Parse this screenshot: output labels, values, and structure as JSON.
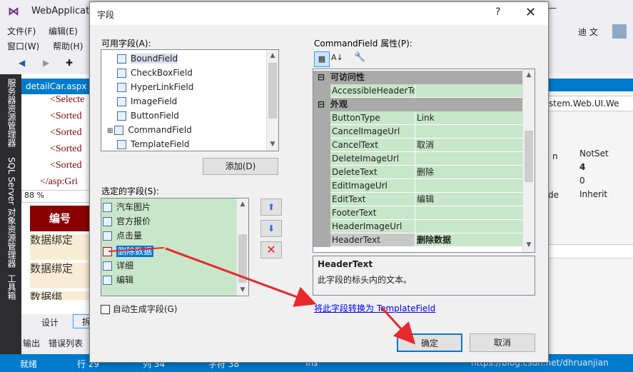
{
  "vs": {
    "title": "WebApplicatio",
    "menu": [
      "文件(F)",
      "编辑(E)",
      "窗口(W)",
      "帮助(H)"
    ],
    "right_menu": [
      "迪 文"
    ],
    "editor_tab": "detailCar.aspx",
    "code_lines": [
      "<Selecte",
      "<Sorted",
      "<Sorted",
      "<Sorted",
      "<Sorted",
      "</asp:Gri"
    ],
    "zoom": "88 %",
    "grid_header": "编号",
    "grid_cells": [
      "数据绑定",
      "数据绑定",
      "数据绑"
    ],
    "bottom_tabs": [
      "设计",
      "拆"
    ],
    "output_tabs": [
      "输出",
      "错误列表"
    ],
    "left_strip": [
      "服务器资源管理器",
      "SQL Server 对象资源管理器",
      "工具箱"
    ],
    "status": {
      "ready": "就绪",
      "line": "行 29",
      "col": "列 34",
      "ch": "字符 38",
      "ins": "Ins"
    },
    "right_panel": {
      "type": "stem.Web.UI.We",
      "rows": [
        [
          "n",
          "NotSet"
        ],
        [
          "",
          "4"
        ],
        [
          "",
          "0"
        ],
        [
          "de",
          "Inherit"
        ]
      ]
    },
    "watermark": "https://blog.csdn.net/dhruanjian"
  },
  "dialog": {
    "title": "字段",
    "help": "?",
    "close": "✕",
    "available_label": "可用字段(A):",
    "available_fields": [
      "BoundField",
      "CheckBoxField",
      "HyperLinkField",
      "ImageField",
      "ButtonField",
      "CommandField",
      "TemplateField"
    ],
    "add_button": "添加(D)",
    "selected_label": "选定的字段(S):",
    "selected_fields": [
      "汽车图片",
      "官方报价",
      "点击量",
      "删除数据",
      "详细",
      "编辑"
    ],
    "auto_generate": "自动生成字段(G)",
    "props_label": "CommandField 属性(P):",
    "categories": [
      "可访问性",
      "外观"
    ],
    "properties": [
      {
        "name": "AccessibleHeaderTe",
        "value": ""
      },
      {
        "name": "ButtonType",
        "value": "Link"
      },
      {
        "name": "CancelImageUrl",
        "value": ""
      },
      {
        "name": "CancelText",
        "value": "取消"
      },
      {
        "name": "DeleteImageUrl",
        "value": ""
      },
      {
        "name": "DeleteText",
        "value": "删除"
      },
      {
        "name": "EditImageUrl",
        "value": ""
      },
      {
        "name": "EditText",
        "value": "编辑"
      },
      {
        "name": "FooterText",
        "value": ""
      },
      {
        "name": "HeaderImageUrl",
        "value": ""
      },
      {
        "name": "HeaderText",
        "value": "删除数据"
      }
    ],
    "desc_title": "HeaderText",
    "desc_text": "此字段的标头内的文本。",
    "convert_link": "将此字段转换为 TemplateField",
    "ok": "确定",
    "cancel": "取消"
  },
  "colors": {
    "accent": "#007acc",
    "prop_bg": "#c8e6c9",
    "arrow": "#e8282b",
    "grid_header": "#8b0000"
  }
}
